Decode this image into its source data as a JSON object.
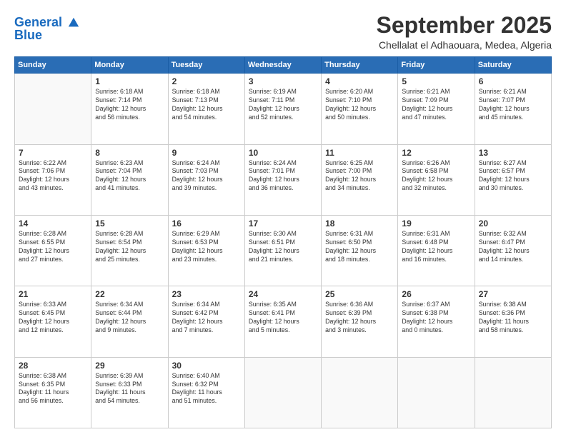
{
  "header": {
    "logo_line1": "General",
    "logo_line2": "Blue",
    "month": "September 2025",
    "location": "Chellalat el Adhaouara, Medea, Algeria"
  },
  "weekdays": [
    "Sunday",
    "Monday",
    "Tuesday",
    "Wednesday",
    "Thursday",
    "Friday",
    "Saturday"
  ],
  "weeks": [
    [
      {
        "day": "",
        "info": ""
      },
      {
        "day": "1",
        "info": "Sunrise: 6:18 AM\nSunset: 7:14 PM\nDaylight: 12 hours\nand 56 minutes."
      },
      {
        "day": "2",
        "info": "Sunrise: 6:18 AM\nSunset: 7:13 PM\nDaylight: 12 hours\nand 54 minutes."
      },
      {
        "day": "3",
        "info": "Sunrise: 6:19 AM\nSunset: 7:11 PM\nDaylight: 12 hours\nand 52 minutes."
      },
      {
        "day": "4",
        "info": "Sunrise: 6:20 AM\nSunset: 7:10 PM\nDaylight: 12 hours\nand 50 minutes."
      },
      {
        "day": "5",
        "info": "Sunrise: 6:21 AM\nSunset: 7:09 PM\nDaylight: 12 hours\nand 47 minutes."
      },
      {
        "day": "6",
        "info": "Sunrise: 6:21 AM\nSunset: 7:07 PM\nDaylight: 12 hours\nand 45 minutes."
      }
    ],
    [
      {
        "day": "7",
        "info": "Sunrise: 6:22 AM\nSunset: 7:06 PM\nDaylight: 12 hours\nand 43 minutes."
      },
      {
        "day": "8",
        "info": "Sunrise: 6:23 AM\nSunset: 7:04 PM\nDaylight: 12 hours\nand 41 minutes."
      },
      {
        "day": "9",
        "info": "Sunrise: 6:24 AM\nSunset: 7:03 PM\nDaylight: 12 hours\nand 39 minutes."
      },
      {
        "day": "10",
        "info": "Sunrise: 6:24 AM\nSunset: 7:01 PM\nDaylight: 12 hours\nand 36 minutes."
      },
      {
        "day": "11",
        "info": "Sunrise: 6:25 AM\nSunset: 7:00 PM\nDaylight: 12 hours\nand 34 minutes."
      },
      {
        "day": "12",
        "info": "Sunrise: 6:26 AM\nSunset: 6:58 PM\nDaylight: 12 hours\nand 32 minutes."
      },
      {
        "day": "13",
        "info": "Sunrise: 6:27 AM\nSunset: 6:57 PM\nDaylight: 12 hours\nand 30 minutes."
      }
    ],
    [
      {
        "day": "14",
        "info": "Sunrise: 6:28 AM\nSunset: 6:55 PM\nDaylight: 12 hours\nand 27 minutes."
      },
      {
        "day": "15",
        "info": "Sunrise: 6:28 AM\nSunset: 6:54 PM\nDaylight: 12 hours\nand 25 minutes."
      },
      {
        "day": "16",
        "info": "Sunrise: 6:29 AM\nSunset: 6:53 PM\nDaylight: 12 hours\nand 23 minutes."
      },
      {
        "day": "17",
        "info": "Sunrise: 6:30 AM\nSunset: 6:51 PM\nDaylight: 12 hours\nand 21 minutes."
      },
      {
        "day": "18",
        "info": "Sunrise: 6:31 AM\nSunset: 6:50 PM\nDaylight: 12 hours\nand 18 minutes."
      },
      {
        "day": "19",
        "info": "Sunrise: 6:31 AM\nSunset: 6:48 PM\nDaylight: 12 hours\nand 16 minutes."
      },
      {
        "day": "20",
        "info": "Sunrise: 6:32 AM\nSunset: 6:47 PM\nDaylight: 12 hours\nand 14 minutes."
      }
    ],
    [
      {
        "day": "21",
        "info": "Sunrise: 6:33 AM\nSunset: 6:45 PM\nDaylight: 12 hours\nand 12 minutes."
      },
      {
        "day": "22",
        "info": "Sunrise: 6:34 AM\nSunset: 6:44 PM\nDaylight: 12 hours\nand 9 minutes."
      },
      {
        "day": "23",
        "info": "Sunrise: 6:34 AM\nSunset: 6:42 PM\nDaylight: 12 hours\nand 7 minutes."
      },
      {
        "day": "24",
        "info": "Sunrise: 6:35 AM\nSunset: 6:41 PM\nDaylight: 12 hours\nand 5 minutes."
      },
      {
        "day": "25",
        "info": "Sunrise: 6:36 AM\nSunset: 6:39 PM\nDaylight: 12 hours\nand 3 minutes."
      },
      {
        "day": "26",
        "info": "Sunrise: 6:37 AM\nSunset: 6:38 PM\nDaylight: 12 hours\nand 0 minutes."
      },
      {
        "day": "27",
        "info": "Sunrise: 6:38 AM\nSunset: 6:36 PM\nDaylight: 11 hours\nand 58 minutes."
      }
    ],
    [
      {
        "day": "28",
        "info": "Sunrise: 6:38 AM\nSunset: 6:35 PM\nDaylight: 11 hours\nand 56 minutes."
      },
      {
        "day": "29",
        "info": "Sunrise: 6:39 AM\nSunset: 6:33 PM\nDaylight: 11 hours\nand 54 minutes."
      },
      {
        "day": "30",
        "info": "Sunrise: 6:40 AM\nSunset: 6:32 PM\nDaylight: 11 hours\nand 51 minutes."
      },
      {
        "day": "",
        "info": ""
      },
      {
        "day": "",
        "info": ""
      },
      {
        "day": "",
        "info": ""
      },
      {
        "day": "",
        "info": ""
      }
    ]
  ]
}
